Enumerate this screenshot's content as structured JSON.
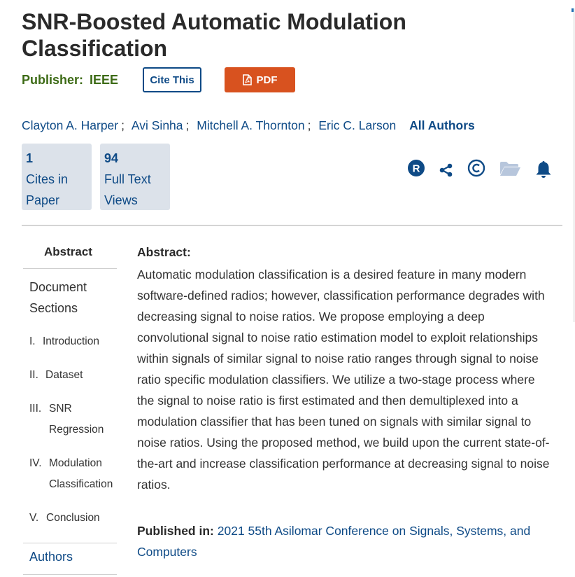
{
  "paper": {
    "title": "SNR-Boosted Automatic Modulation Classification",
    "publisher_label": "Publisher:",
    "publisher_name": "IEEE"
  },
  "buttons": {
    "cite": "Cite This",
    "pdf": "PDF"
  },
  "authors": [
    "Clayton A. Harper",
    "Avi Sinha",
    "Mitchell A. Thornton",
    "Eric C. Larson"
  ],
  "author_separator": ";",
  "all_authors_label": "All Authors",
  "metrics": [
    {
      "number": "1",
      "label": "Cites in Paper"
    },
    {
      "number": "94",
      "label": "Full Text Views"
    }
  ],
  "tool_icons": [
    "rights-icon",
    "share-icon",
    "copyright-icon",
    "folder-icon",
    "bell-icon"
  ],
  "nav": {
    "abstract": "Abstract",
    "document_sections": "Document Sections",
    "sections": [
      {
        "num": "I.",
        "label": "Introduction"
      },
      {
        "num": "II.",
        "label": "Dataset"
      },
      {
        "num": "III.",
        "label": "SNR Regression"
      },
      {
        "num": "IV.",
        "label": "Modulation Classification"
      },
      {
        "num": "V.",
        "label": "Conclusion"
      }
    ],
    "authors": "Authors"
  },
  "abstract": {
    "heading": "Abstract:",
    "text": "Automatic modulation classification is a desired feature in many modern software-defined radios; however, classification performance degrades with decreasing signal to noise ratios. We propose employing a deep convolutional signal to noise ratio estimation model to exploit relationships within signals of similar signal to noise ratio ranges through signal to noise ratio specific modulation classifiers. We utilize a two-stage process where the signal to noise ratio is first estimated and then demultiplexed into a modulation classifier that has been tuned on signals with similar signal to noise ratios. Using the proposed method, we build upon the current state-of-the-art and increase classification performance at decreasing signal to noise ratios."
  },
  "published": {
    "label": "Published in:",
    "venue": "2021 55th Asilomar Conference on Signals, Systems, and Computers"
  },
  "colors": {
    "link": "#0e4a86",
    "publisher_green": "#3d6b16",
    "pdf_orange": "#d8521f",
    "metric_bg": "#dce2ea"
  }
}
